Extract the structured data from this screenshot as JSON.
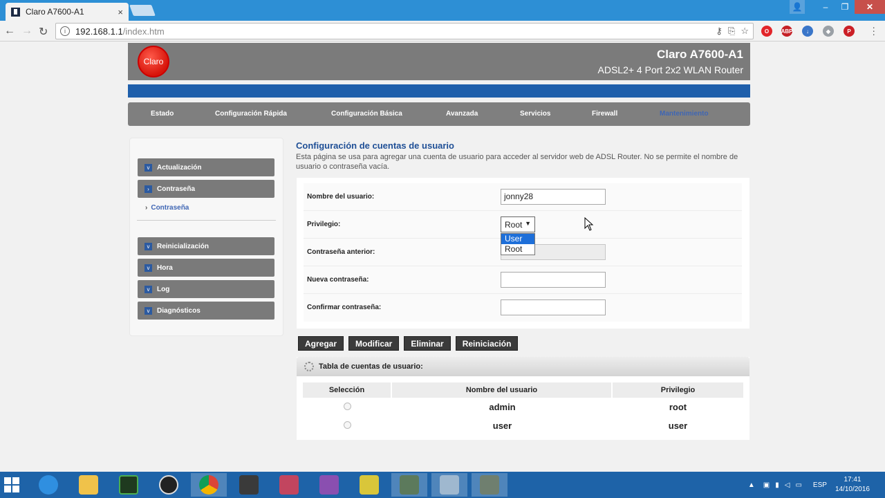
{
  "browser": {
    "tab_title": "Claro A7600-A1",
    "tab_close": "×",
    "url_host": "192.168.1.1",
    "url_path": "/index.htm",
    "window_controls": [
      "–",
      "❐",
      "✕"
    ]
  },
  "router": {
    "logo_text": "Claro",
    "model": "Claro A7600-A1",
    "subtitle": "ADSL2+ 4 Port 2x2 WLAN Router"
  },
  "main_nav": [
    {
      "label": "Estado"
    },
    {
      "label": "Configuración Rápida"
    },
    {
      "label": "Configuración Básica"
    },
    {
      "label": "Avanzada"
    },
    {
      "label": "Servicios"
    },
    {
      "label": "Firewall"
    },
    {
      "label": "Mantenimiento",
      "active": true
    }
  ],
  "sidebar": {
    "items": [
      {
        "label": "Actualización"
      },
      {
        "label": "Contraseña"
      },
      {
        "label": "Reinicialización"
      },
      {
        "label": "Hora"
      },
      {
        "label": "Log"
      },
      {
        "label": "Diagnósticos"
      }
    ],
    "subitem": "Contraseña"
  },
  "page": {
    "title": "Configuración de cuentas de usuario",
    "description": "Esta página se usa para agregar una cuenta de usuario para acceder al servidor web de ADSL Router. No se permite el nombre de usuario o contraseña vacía."
  },
  "form": {
    "username_label": "Nombre del usuario:",
    "username_value": "jonny28",
    "privilege_label": "Privilegio:",
    "privilege_value": "Root",
    "privilege_options": [
      "User",
      "Root"
    ],
    "old_password_label": "Contraseña anterior:",
    "new_password_label": "Nueva contraseña:",
    "confirm_password_label": "Confirmar contraseña:"
  },
  "buttons": {
    "add": "Agregar",
    "modify": "Modificar",
    "delete": "Eliminar",
    "reset": "Reiniciación"
  },
  "table": {
    "title": "Tabla de cuentas de usuario:",
    "columns": [
      "Selección",
      "Nombre del usuario",
      "Privilegio"
    ],
    "rows": [
      {
        "name": "admin",
        "privilege": "root"
      },
      {
        "name": "user",
        "privilege": "user"
      }
    ]
  },
  "taskbar": {
    "language": "ESP",
    "time": "17:41",
    "date": "14/10/2016"
  }
}
